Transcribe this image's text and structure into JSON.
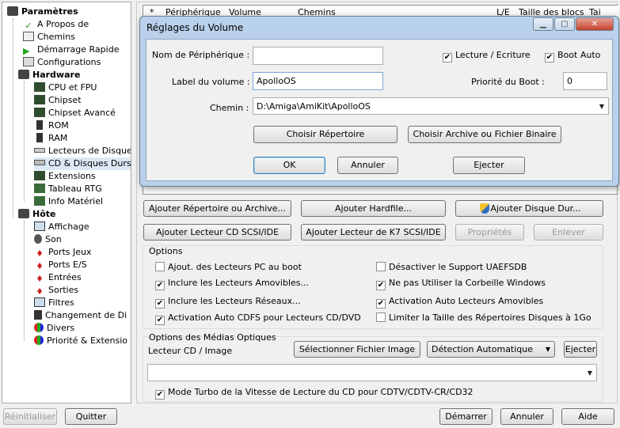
{
  "tree": {
    "root": "Paramètres",
    "items": [
      {
        "label": "A Propos de"
      },
      {
        "label": "Chemins"
      },
      {
        "label": "Démarrage Rapide"
      },
      {
        "label": "Configurations"
      }
    ],
    "hardware": {
      "label": "Hardware",
      "items": [
        {
          "label": "CPU et FPU"
        },
        {
          "label": "Chipset"
        },
        {
          "label": "Chipset Avancé"
        },
        {
          "label": "ROM"
        },
        {
          "label": "RAM"
        },
        {
          "label": "Lecteurs de Disque"
        },
        {
          "label": "CD & Disques Durs"
        },
        {
          "label": "Extensions"
        },
        {
          "label": "Tableau RTG"
        },
        {
          "label": "Info Matériel"
        }
      ]
    },
    "host": {
      "label": "Hôte",
      "items": [
        {
          "label": "Affichage"
        },
        {
          "label": "Son"
        },
        {
          "label": "Ports Jeux"
        },
        {
          "label": "Ports E/S"
        },
        {
          "label": "Entrées"
        },
        {
          "label": "Sorties"
        },
        {
          "label": "Filtres"
        },
        {
          "label": "Changement de Di"
        },
        {
          "label": "Divers"
        },
        {
          "label": "Priorité & Extensio"
        }
      ]
    }
  },
  "table": {
    "headers": [
      "*",
      "Périphérique",
      "Volume",
      "Chemins",
      "L/E",
      "Taille des blocs",
      "Tai"
    ]
  },
  "buttons_row1": {
    "add_dir": "Ajouter Répertoire ou Archive...",
    "add_hardfile": "Ajouter Hardfile...",
    "add_harddisk": "Ajouter Disque Dur..."
  },
  "buttons_row2": {
    "add_cd": "Ajouter Lecteur CD SCSI/IDE",
    "add_tape": "Ajouter Lecteur de K7 SCSI/IDE",
    "properties": "Propriétés",
    "remove": "Enlever"
  },
  "options": {
    "title": "Options",
    "left": [
      {
        "label": "Ajout. des Lecteurs PC au boot",
        "checked": false
      },
      {
        "label": "Inclure les Lecteurs Amovibles...",
        "checked": true
      },
      {
        "label": "Inclure les Lecteurs Réseaux...",
        "checked": true
      },
      {
        "label": "Activation Auto CDFS pour Lecteurs CD/DVD",
        "checked": true
      }
    ],
    "right": [
      {
        "label": "Désactiver le Support UAEFSDB",
        "checked": false
      },
      {
        "label": "Ne pas Utiliser la Corbeille Windows",
        "checked": true
      },
      {
        "label": "Activation Auto Lecteurs Amovibles",
        "checked": true
      },
      {
        "label": "Limiter la Taille des Répertoires Disques à 1Go",
        "checked": false
      }
    ]
  },
  "optical": {
    "title": "Options des Médias Optiques",
    "cd_label": "Lecteur CD / Image",
    "select_image": "Sélectionner Fichier Image",
    "detection": "Détection Automatique",
    "eject": "Ejecter",
    "path": "",
    "turbo": "Mode Turbo de la Vitesse de Lecture du CD pour CDTV/CDTV-CR/CD32",
    "turbo_checked": true
  },
  "bottom": {
    "reset": "Réinitialiser",
    "quit": "Quitter",
    "start": "Démarrer",
    "cancel": "Annuler",
    "help": "Aide"
  },
  "dialog": {
    "title": "Réglages du Volume",
    "device_label": "Nom de Périphérique :",
    "device_value": "",
    "volume_label": "Label du volume :",
    "volume_value": "ApolloOS",
    "path_label": "Chemin :",
    "path_value": "D:\\Amiga\\AmiKit\\ApolloOS",
    "rw_label": "Lecture / Ecriture",
    "rw_checked": true,
    "boot_auto_label": "Boot Auto",
    "boot_auto_checked": true,
    "boot_priority_label": "Priorité du Boot :",
    "boot_priority_value": "0",
    "choose_dir": "Choisir Répertoire",
    "choose_archive": "Choisir Archive ou Fichier Binaire",
    "ok": "OK",
    "cancel": "Annuler",
    "eject": "Ejecter"
  }
}
